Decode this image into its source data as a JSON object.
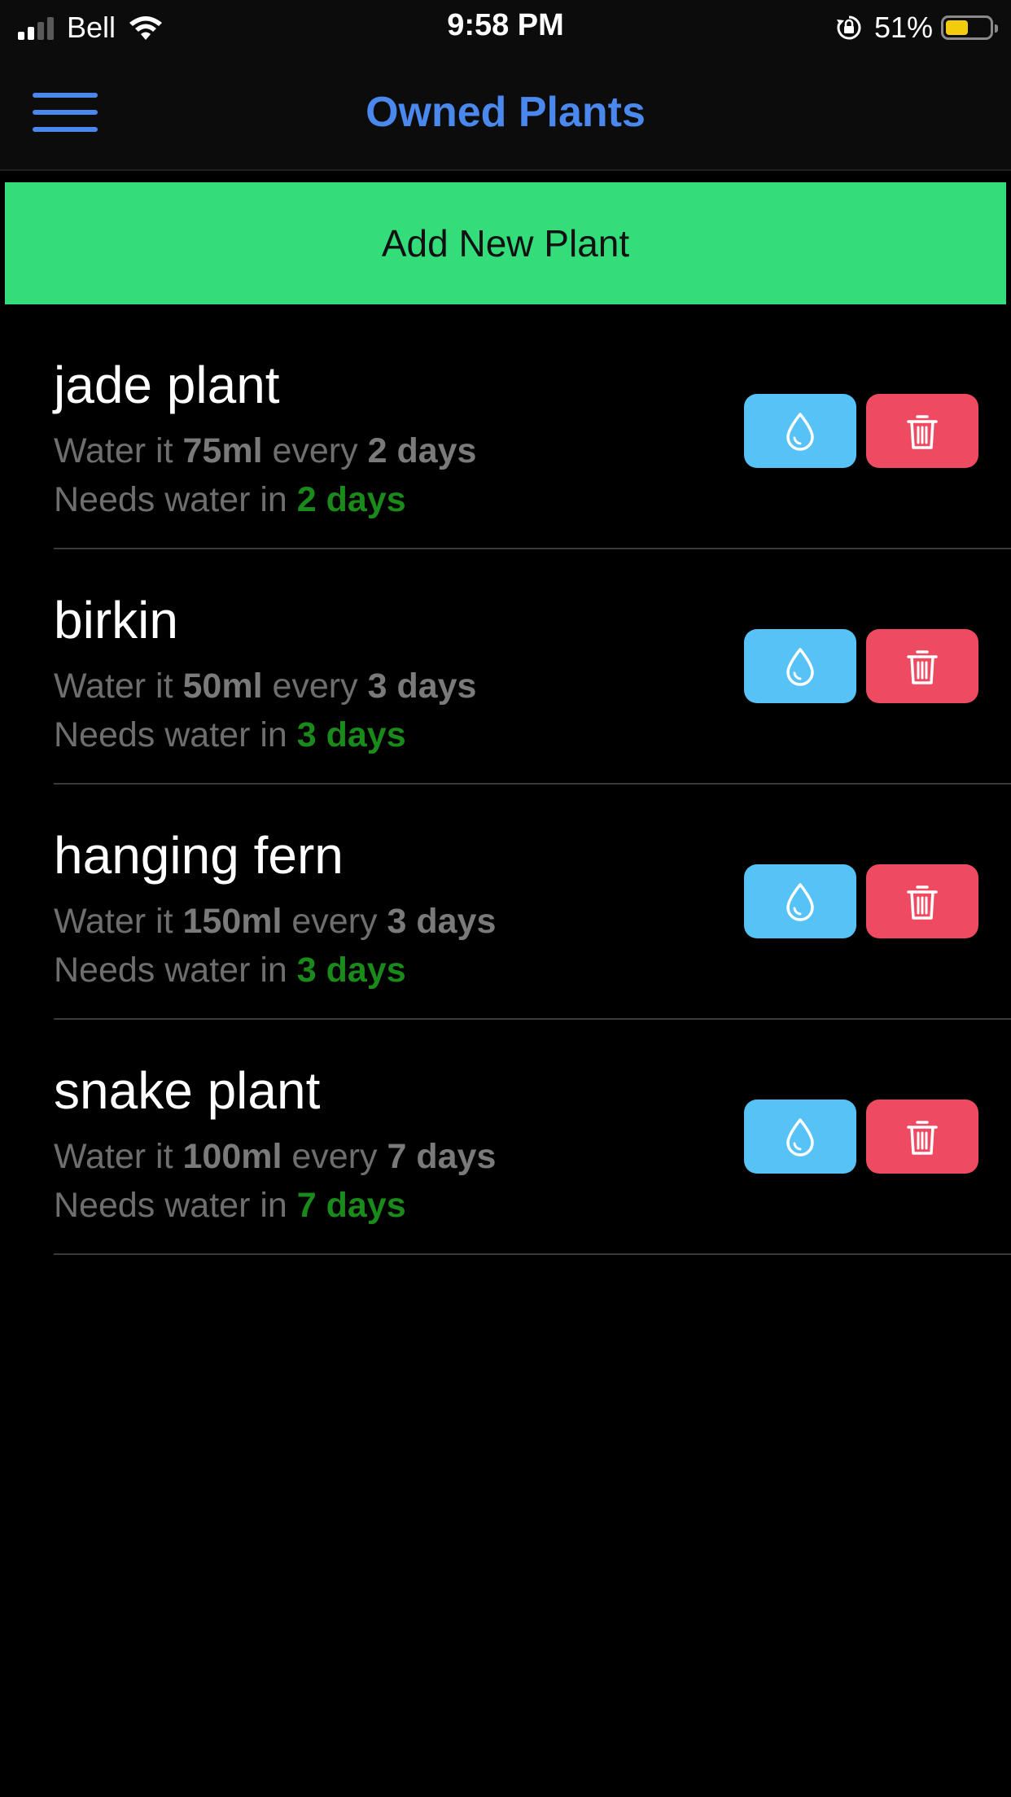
{
  "status_bar": {
    "carrier": "Bell",
    "time": "9:58 PM",
    "battery_percent": "51%",
    "battery_level": 0.51,
    "battery_color": "#f4cc0e",
    "signal_bars": 2,
    "icons": [
      "signal-icon",
      "wifi-icon",
      "rotation-lock-icon",
      "battery-icon"
    ]
  },
  "header": {
    "title": "Owned Plants",
    "menu_icon": "hamburger-menu-icon",
    "accent_color": "#4a88ee"
  },
  "add_button": {
    "label": "Add New Plant",
    "color": "#33dd7a"
  },
  "plant_text": {
    "water_it": "Water it",
    "every": "every",
    "needs_water_in": "Needs water in"
  },
  "plants": [
    {
      "name": "jade plant",
      "amount": "75ml",
      "interval": "2 days",
      "due": "2 days"
    },
    {
      "name": "birkin",
      "amount": "50ml",
      "interval": "3 days",
      "due": "3 days"
    },
    {
      "name": "hanging fern",
      "amount": "150ml",
      "interval": "3 days",
      "due": "3 days"
    },
    {
      "name": "snake plant",
      "amount": "100ml",
      "interval": "7 days",
      "due": "7 days"
    }
  ],
  "actions": {
    "water_icon": "water-drop-icon",
    "water_color": "#56c2f5",
    "delete_icon": "trash-icon",
    "delete_color": "#ee4a62"
  }
}
